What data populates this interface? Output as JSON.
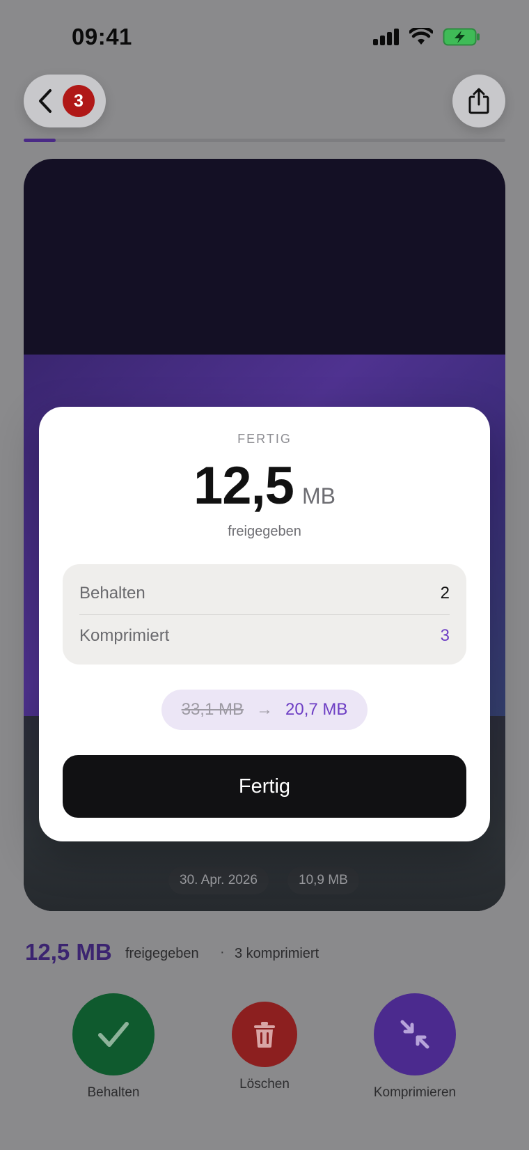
{
  "status_bar": {
    "time": "09:41"
  },
  "nav": {
    "back_badge_count": "3",
    "progress_fraction": 0.066
  },
  "photo": {
    "date": "30. Apr. 2026",
    "size": "10,9 MB"
  },
  "summary": {
    "freed_amount": "12,5 MB",
    "freed_label": "freigegeben",
    "separator": "·",
    "compressed_label": "3 komprimiert"
  },
  "actions": {
    "keep_label": "Behalten",
    "delete_label": "Löschen",
    "compress_label": "Komprimieren"
  },
  "modal": {
    "eyebrow": "FERTIG",
    "amount_value": "12,5",
    "amount_unit": "MB",
    "amount_sub": "freigegeben",
    "stats": [
      {
        "label": "Behalten",
        "value": "2"
      },
      {
        "label": "Komprimiert",
        "value": "3"
      }
    ],
    "size_before": "33,1 MB",
    "size_arrow": "→",
    "size_after": "20,7 MB",
    "done_label": "Fertig"
  },
  "colors": {
    "accent_purple": "#6d3ec4",
    "keep_green": "#0f5a2e",
    "delete_red": "#8c1f1f",
    "compress_purple": "#4b2a8e",
    "badge_red": "#b01817"
  },
  "icons": [
    "chevron-left-icon",
    "share-icon",
    "checkmark-icon",
    "trash-icon",
    "compress-arrows-icon",
    "signal-icon",
    "wifi-icon",
    "battery-charging-icon"
  ]
}
